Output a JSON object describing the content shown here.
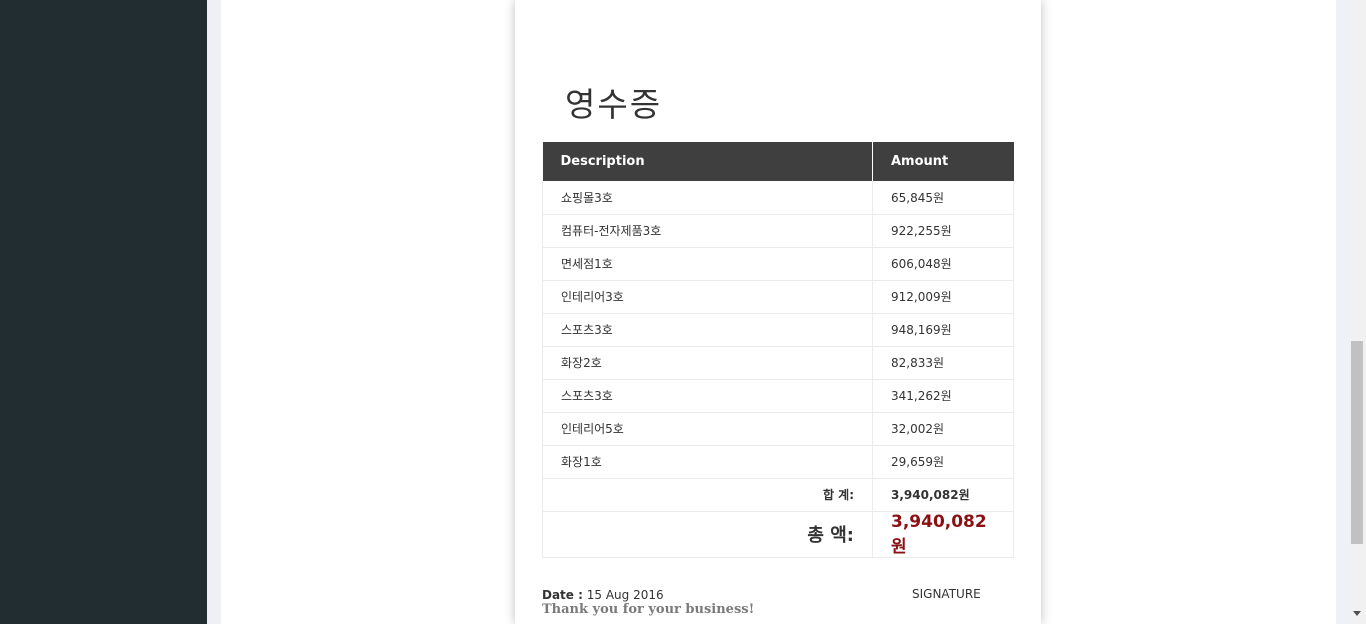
{
  "receipt": {
    "title": "영수증",
    "columns": {
      "description": "Description",
      "amount": "Amount"
    },
    "items": [
      {
        "description": "쇼핑몰3호",
        "amount": "65,845원"
      },
      {
        "description": "컴퓨터-전자제품3호",
        "amount": "922,255원"
      },
      {
        "description": "면세점1호",
        "amount": "606,048원"
      },
      {
        "description": "인테리어3호",
        "amount": "912,009원"
      },
      {
        "description": "스포츠3호",
        "amount": "948,169원"
      },
      {
        "description": "화장2호",
        "amount": "82,833원"
      },
      {
        "description": "스포츠3호",
        "amount": "341,262원"
      },
      {
        "description": "인테리어5호",
        "amount": "32,002원"
      },
      {
        "description": "화장1호",
        "amount": "29,659원"
      }
    ],
    "subtotal": {
      "label": "합 계:",
      "value": "3,940,082원"
    },
    "total": {
      "label": "총 액:",
      "value": "3,940,082원"
    },
    "footer": {
      "date_label": "Date :",
      "date_value": "15 Aug 2016",
      "thanks": "Thank you for your business!",
      "signature": "SIGNATURE"
    }
  },
  "colors": {
    "sidebar": "#222d32",
    "table_header": "#3f3f3f",
    "total_value": "#8b1014"
  }
}
